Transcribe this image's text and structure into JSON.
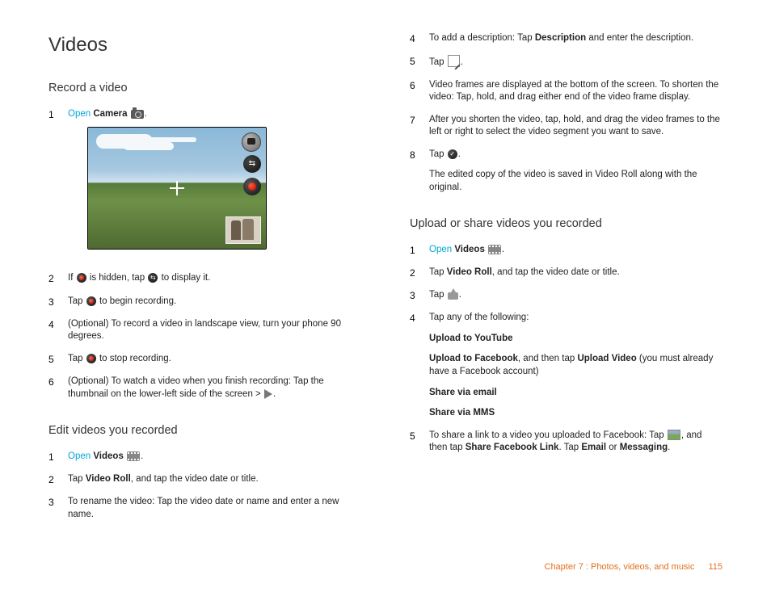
{
  "title": "Videos",
  "left": {
    "s1": {
      "heading": "Record a video",
      "i1_open": "Open",
      "i1_app": "Camera",
      "i2a": "If ",
      "i2b": " is hidden, tap ",
      "i2c": " to display it.",
      "i3a": "Tap ",
      "i3b": " to begin recording.",
      "i4": "(Optional) To record a video in landscape view, turn your phone 90 degrees.",
      "i5a": "Tap ",
      "i5b": " to stop recording.",
      "i6a": "(Optional) To watch a video when you finish recording: Tap the thumbnail on the lower-left side of the screen > ",
      "i6b": "."
    },
    "s2": {
      "heading": "Edit videos you recorded",
      "i1_open": "Open",
      "i1_app": "Videos",
      "i2a": "Tap ",
      "i2b": "Video Roll",
      "i2c": ", and tap the video date or title.",
      "i3": "To rename the video: Tap the video date or name and enter a new name."
    }
  },
  "right": {
    "cont": {
      "i4a": "To add a description: Tap ",
      "i4b": "Description",
      "i4c": " and enter the description.",
      "i5a": "Tap ",
      "i5b": ".",
      "i6": "Video frames are displayed at the bottom of the screen. To shorten the video: Tap, hold, and drag either end of the video frame display.",
      "i7": "After you shorten the video, tap, hold, and drag the video frames to the left or right to select the video segment you want to save.",
      "i8a": "Tap ",
      "i8b": ".",
      "i8_note": "The edited copy of the video is saved in Video Roll along with the original."
    },
    "s3": {
      "heading": "Upload or share videos you recorded",
      "i1_open": "Open",
      "i1_app": "Videos",
      "i2a": "Tap ",
      "i2b": "Video Roll",
      "i2c": ", and tap the video date or title.",
      "i3a": "Tap ",
      "i3b": ".",
      "i4a": "Tap any of the following:",
      "opt1": "Upload to YouTube",
      "opt2a": "Upload to Facebook",
      "opt2b": ", and then tap ",
      "opt2c": "Upload Video",
      "opt2d": " (you must already have a Facebook account)",
      "opt3": "Share via email",
      "opt4": "Share via MMS",
      "i5a": "To share a link to a video you uploaded to Facebook: Tap ",
      "i5b": ", and then tap ",
      "i5c": "Share Facebook Link",
      "i5d": ". Tap ",
      "i5e": "Email",
      "i5f": " or ",
      "i5g": "Messaging",
      "i5h": "."
    }
  },
  "footer": {
    "chapter": "Chapter 7 : Photos, videos, and music",
    "page": "115"
  }
}
